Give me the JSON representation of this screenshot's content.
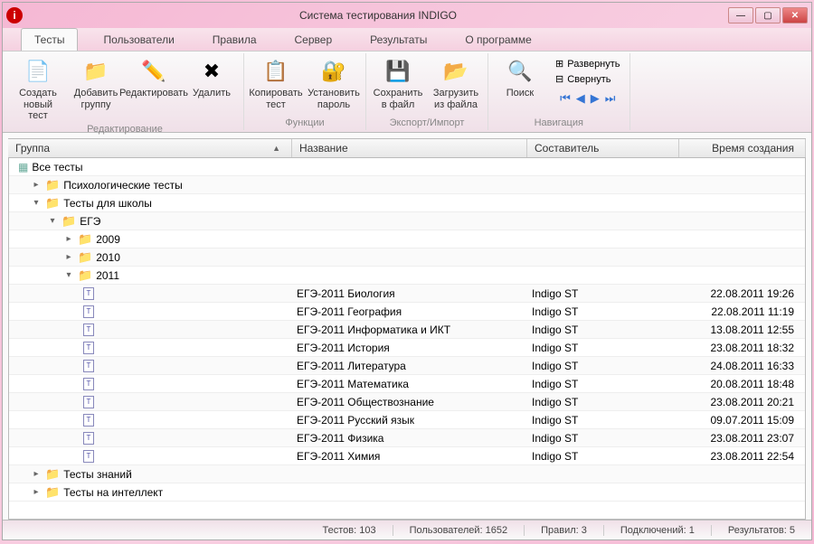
{
  "window": {
    "title": "Система тестирования INDIGO"
  },
  "tabs": [
    "Тесты",
    "Пользователи",
    "Правила",
    "Сервер",
    "Результаты",
    "О программе"
  ],
  "active_tab": 0,
  "ribbon": {
    "groups": [
      {
        "label": "Редактирование",
        "items": [
          {
            "icon": "📄",
            "label": "Создать новый тест",
            "name": "create-test-button"
          },
          {
            "icon": "📁",
            "label": "Добавить группу",
            "name": "add-group-button"
          },
          {
            "icon": "✏️",
            "label": "Редактировать",
            "name": "edit-button"
          },
          {
            "icon": "✖",
            "label": "Удалить",
            "name": "delete-button"
          }
        ]
      },
      {
        "label": "Функции",
        "items": [
          {
            "icon": "📋",
            "label": "Копировать тест",
            "name": "copy-test-button"
          },
          {
            "icon": "🔐",
            "label": "Установить пароль",
            "name": "set-password-button"
          }
        ]
      },
      {
        "label": "Экспорт/Импорт",
        "items": [
          {
            "icon": "💾",
            "label": "Сохранить в файл",
            "name": "save-file-button"
          },
          {
            "icon": "📂",
            "label": "Загрузить из файла",
            "name": "load-file-button"
          }
        ]
      },
      {
        "label": "Навигация",
        "search": {
          "icon": "🔍",
          "label": "Поиск",
          "name": "search-button"
        },
        "small": [
          {
            "icon": "⊞",
            "label": "Развернуть",
            "name": "expand-all-button"
          },
          {
            "icon": "⊟",
            "label": "Свернуть",
            "name": "collapse-all-button"
          }
        ]
      }
    ]
  },
  "columns": {
    "group": "Группа",
    "name": "Название",
    "author": "Составитель",
    "date": "Время создания"
  },
  "tree": [
    {
      "type": "root",
      "indent": 0,
      "label": "Все тесты"
    },
    {
      "type": "folder",
      "indent": 1,
      "expander": "▸",
      "label": "Психологические тесты"
    },
    {
      "type": "folder",
      "indent": 1,
      "expander": "▾",
      "label": "Тесты для школы"
    },
    {
      "type": "folder",
      "indent": 2,
      "expander": "▾",
      "label": "ЕГЭ"
    },
    {
      "type": "folder",
      "indent": 3,
      "expander": "▸",
      "label": "2009"
    },
    {
      "type": "folder",
      "indent": 3,
      "expander": "▸",
      "label": "2010"
    },
    {
      "type": "folder",
      "indent": 3,
      "expander": "▾",
      "label": "2011"
    },
    {
      "type": "test",
      "indent": 4,
      "name": "ЕГЭ-2011 Биология",
      "author": "Indigo ST",
      "date": "22.08.2011 19:26"
    },
    {
      "type": "test",
      "indent": 4,
      "name": "ЕГЭ-2011 География",
      "author": "Indigo ST",
      "date": "22.08.2011 11:19"
    },
    {
      "type": "test",
      "indent": 4,
      "name": "ЕГЭ-2011 Информатика и ИКТ",
      "author": "Indigo ST",
      "date": "13.08.2011 12:55"
    },
    {
      "type": "test",
      "indent": 4,
      "name": "ЕГЭ-2011 История",
      "author": "Indigo ST",
      "date": "23.08.2011 18:32"
    },
    {
      "type": "test",
      "indent": 4,
      "name": "ЕГЭ-2011 Литература",
      "author": "Indigo ST",
      "date": "24.08.2011 16:33"
    },
    {
      "type": "test",
      "indent": 4,
      "name": "ЕГЭ-2011 Математика",
      "author": "Indigo ST",
      "date": "20.08.2011 18:48"
    },
    {
      "type": "test",
      "indent": 4,
      "name": "ЕГЭ-2011 Обществознание",
      "author": "Indigo ST",
      "date": "23.08.2011 20:21"
    },
    {
      "type": "test",
      "indent": 4,
      "name": "ЕГЭ-2011 Русский язык",
      "author": "Indigo ST",
      "date": "09.07.2011 15:09"
    },
    {
      "type": "test",
      "indent": 4,
      "name": "ЕГЭ-2011 Физика",
      "author": "Indigo ST",
      "date": "23.08.2011 23:07"
    },
    {
      "type": "test",
      "indent": 4,
      "name": "ЕГЭ-2011 Химия",
      "author": "Indigo ST",
      "date": "23.08.2011 22:54"
    },
    {
      "type": "folder",
      "indent": 1,
      "expander": "▸",
      "label": "Тесты знаний"
    },
    {
      "type": "folder",
      "indent": 1,
      "expander": "▸",
      "label": "Тесты на интеллект"
    }
  ],
  "status": {
    "tests": "Тестов: 103",
    "users": "Пользователей: 1652",
    "rules": "Правил: 3",
    "connections": "Подключений: 1",
    "results": "Результатов: 5"
  }
}
